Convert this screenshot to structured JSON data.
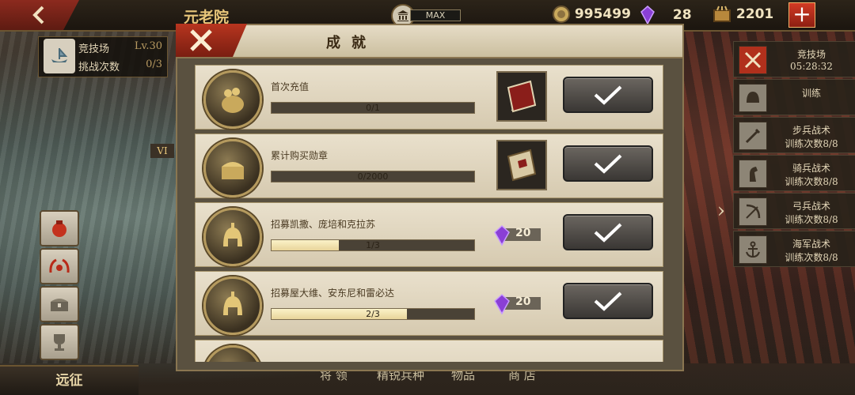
{
  "topbar": {
    "title": "元老院",
    "max_label": "MAX",
    "coins": "995499",
    "gems": "28",
    "food": "2201",
    "plus_label": "+"
  },
  "left": {
    "arena_label": "竞技场",
    "arena_level": "Lv.30",
    "challenge_label": "挑战次数",
    "challenge_count": "0/3",
    "vi_label": "VI",
    "expedition": "远征"
  },
  "bottom_tabs": [
    "将 领",
    "精锐兵种",
    "物品",
    "商 店"
  ],
  "right_panel": [
    {
      "title": "竞技场",
      "sub": "05:28:32"
    },
    {
      "title": "训练",
      "sub": ""
    },
    {
      "title": "步兵战术",
      "sub": "训练次数8/8"
    },
    {
      "title": "骑兵战术",
      "sub": "训练次数8/8"
    },
    {
      "title": "弓兵战术",
      "sub": "训练次数8/8"
    },
    {
      "title": "海军战术",
      "sub": "训练次数8/8"
    }
  ],
  "dialog": {
    "title": "成就",
    "achievements": [
      {
        "title": "首次充值",
        "progress_text": "0/1",
        "progress": 0,
        "reward_type": "item",
        "reward_icon": "book-item-icon"
      },
      {
        "title": "累计购买勋章",
        "progress_text": "0/2000",
        "progress": 0,
        "reward_type": "item",
        "reward_icon": "scroll-item-icon"
      },
      {
        "title": "招募凯撒、庞培和克拉苏",
        "progress_text": "1/3",
        "progress": 0.333,
        "reward_type": "gem",
        "reward_value": "20"
      },
      {
        "title": "招募屋大维、安东尼和雷必达",
        "progress_text": "2/3",
        "progress": 0.667,
        "reward_type": "gem",
        "reward_value": "20"
      }
    ]
  },
  "colors": {
    "accent_red": "#b7351f",
    "gold": "#e8c67a",
    "gem_purple": "#8a3fd6"
  }
}
